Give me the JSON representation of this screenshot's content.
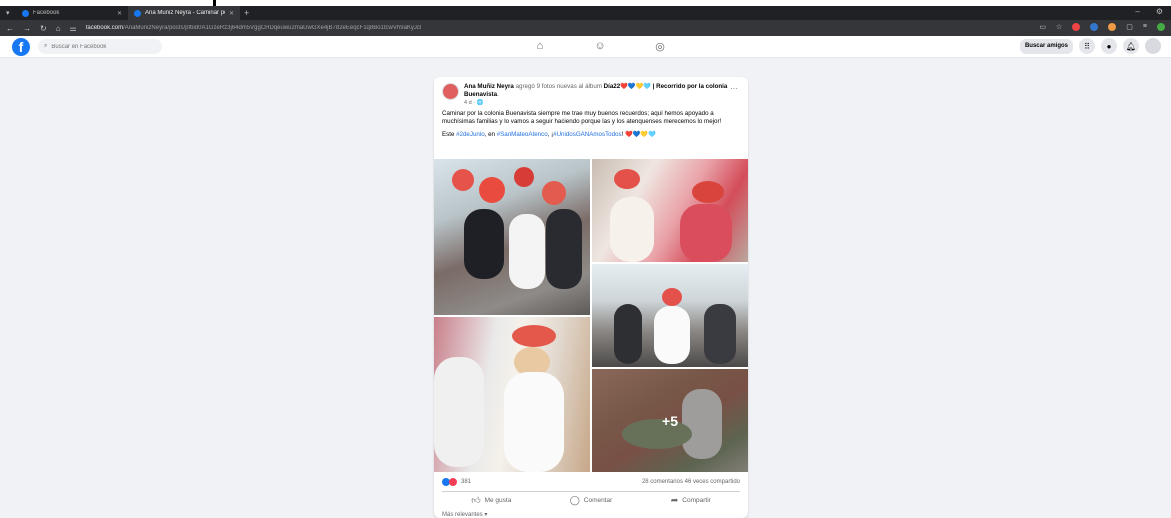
{
  "browser": {
    "tabs": [
      {
        "label": "Facebook",
        "active": false
      },
      {
        "label": "Ana Muñiz Neyra - Caminar po",
        "active": true
      }
    ],
    "url_host": "facebook.com",
    "url_path": "/AnaMunizNeyra/posts/pfbid0A1GzeRz3j64dm5VggCHDqeuwu2maUwGXe4jB782eEeqcF1q8Bo1tcwVh9aKyJcl"
  },
  "header": {
    "search_placeholder": "Buscar en Facebook",
    "find_friends_label": "Buscar amigos",
    "brand_color": "#1877f2"
  },
  "post": {
    "author": "Ana Muñiz Neyra",
    "action_text": " agregó 9 fotos nuevas al álbum ",
    "album": "Día22❤️💙💛🩵 | Recorrido por la colonia Buenavista",
    "album_end": ".",
    "meta": "4 d · 🌐",
    "body": "Caminar por la colonia Buenavista siempre me trae muy buenos recuerdos; aquí hemos apoyado a muchísimas familias y lo vamos a seguir haciendo porque las y los atenquenses merecemos lo mejor!",
    "line2_prefix": "Este ",
    "hashtag1": "#2deJunio",
    "line2_mid": ", en ",
    "hashtag2": "#SanMateoAtenco",
    "line2_mid2": ", ¡",
    "hashtag3": "#UnidosGANAmosTodos",
    "line2_suffix": "! ❤️💙💛🩵",
    "more_photos": "+5",
    "reactions_count": "381",
    "comments_shares": "28 comentarios  46 veces compartido",
    "like_label": "Me gusta",
    "comment_label": "Comentar",
    "share_label": "Compartir",
    "relevant_label": "Más relevantes ▾"
  }
}
